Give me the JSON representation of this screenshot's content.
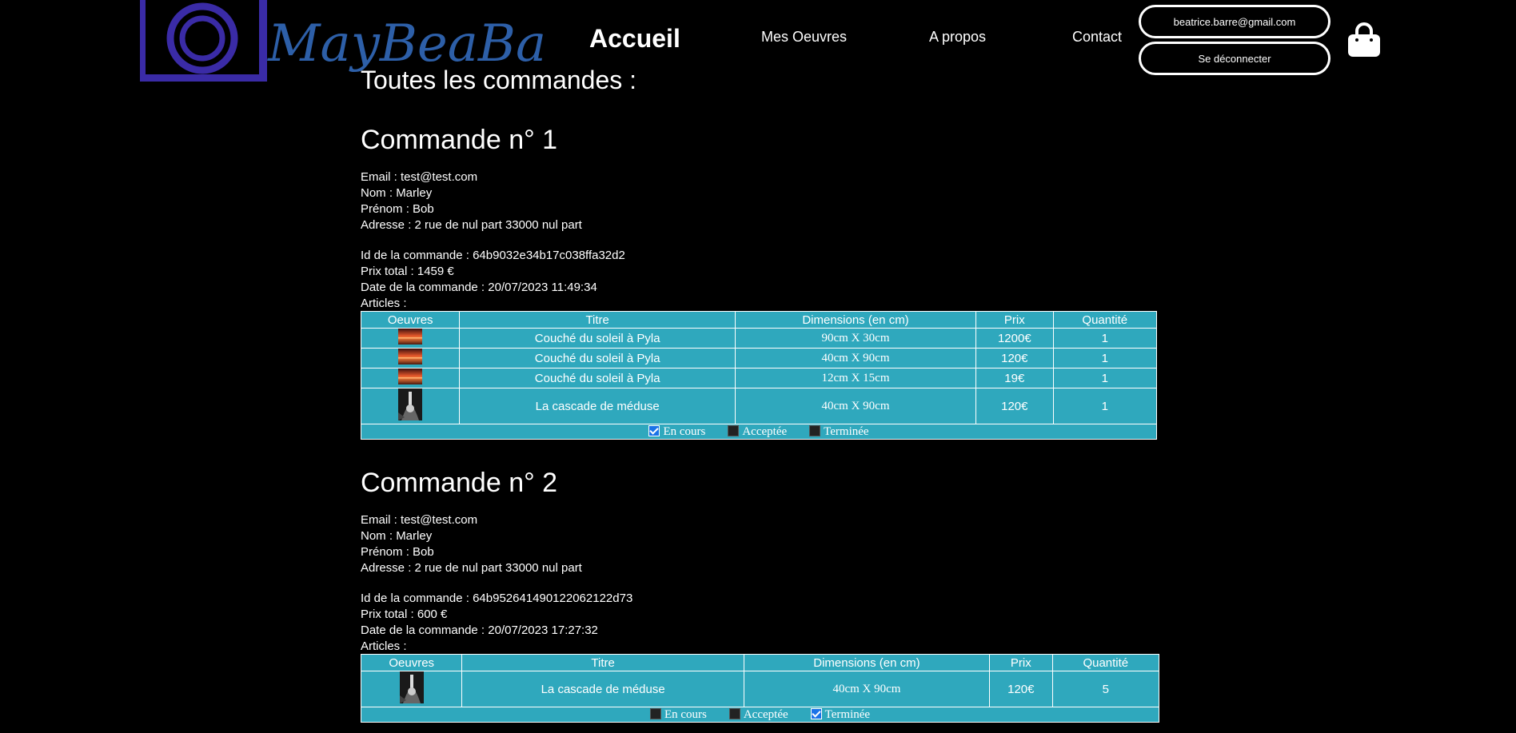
{
  "header": {
    "logo_text": "MayBeaBa",
    "nav": {
      "home": "Accueil",
      "works": "Mes Oeuvres",
      "about": "A propos",
      "contact": "Contact"
    },
    "account_email": "beatrice.barre@gmail.com",
    "logout": "Se déconnecter",
    "cart_icon": "shopping-bag-icon"
  },
  "page": {
    "title": "Toutes les commandes :"
  },
  "labels": {
    "email": "Email : ",
    "nom": "Nom : ",
    "prenom": "Prénom : ",
    "adresse": "Adresse : ",
    "id": "Id de la commande : ",
    "prix_total": "Prix total : ",
    "date": "Date de la commande : ",
    "articles": "Articles :"
  },
  "table_headers": [
    "Oeuvres",
    "Titre",
    "Dimensions (en cm)",
    "Prix",
    "Quantité"
  ],
  "status_labels": [
    "En cours",
    "Acceptée",
    "Terminée"
  ],
  "orders": [
    {
      "title": "Commande n° 1",
      "email": "test@test.com",
      "nom": "Marley",
      "prenom": "Bob",
      "adresse": "2 rue de nul part 33000 nul part",
      "id": "64b9032e34b17c038ffa32d2",
      "prix_total": "1459 €",
      "date": "20/07/2023 11:49:34",
      "items": [
        {
          "thumb": "sunset",
          "titre": "Couché du soleil à Pyla",
          "dim": "90cm X 30cm",
          "prix": "1200€",
          "qte": "1"
        },
        {
          "thumb": "sunset",
          "titre": "Couché du soleil à Pyla",
          "dim": "40cm X 90cm",
          "prix": "120€",
          "qte": "1"
        },
        {
          "thumb": "sunset",
          "titre": "Couché du soleil à Pyla",
          "dim": "12cm X 15cm",
          "prix": "19€",
          "qte": "1"
        },
        {
          "thumb": "waterfall",
          "titre": "La cascade de méduse",
          "dim": "40cm X 90cm",
          "prix": "120€",
          "qte": "1"
        }
      ],
      "status": [
        true,
        false,
        false
      ]
    },
    {
      "title": "Commande n° 2",
      "email": "test@test.com",
      "nom": "Marley",
      "prenom": "Bob",
      "adresse": "2 rue de nul part 33000 nul part",
      "id": "64b952641490122062122d73",
      "prix_total": "600 €",
      "date": "20/07/2023 17:27:32",
      "items": [
        {
          "thumb": "waterfall",
          "titre": "La cascade de méduse",
          "dim": "40cm X 90cm",
          "prix": "120€",
          "qte": "5"
        }
      ],
      "status": [
        false,
        false,
        true
      ]
    }
  ]
}
